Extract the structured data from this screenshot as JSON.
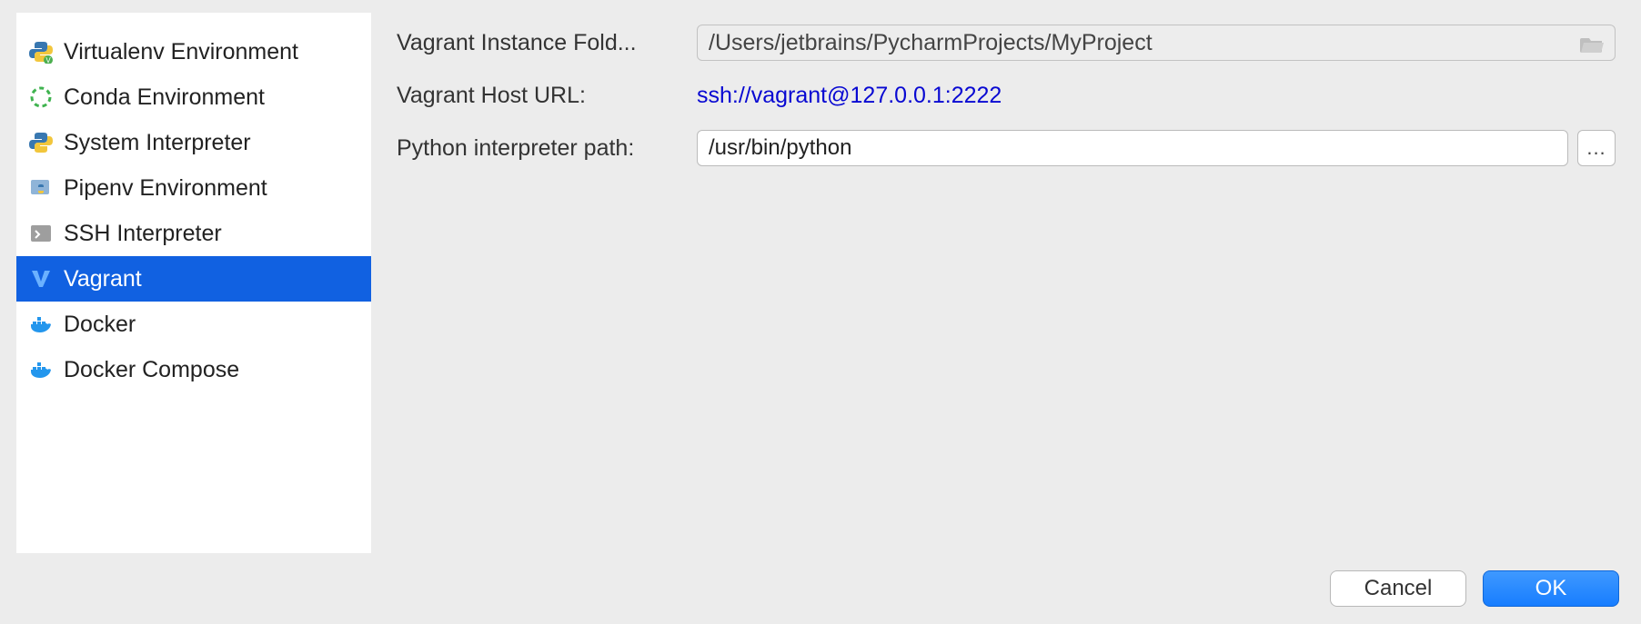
{
  "sidebar": {
    "items": [
      {
        "label": "Virtualenv Environment",
        "icon": "python-v",
        "selected": false
      },
      {
        "label": "Conda Environment",
        "icon": "conda",
        "selected": false
      },
      {
        "label": "System Interpreter",
        "icon": "python",
        "selected": false
      },
      {
        "label": "Pipenv Environment",
        "icon": "pipenv",
        "selected": false
      },
      {
        "label": "SSH Interpreter",
        "icon": "ssh",
        "selected": false
      },
      {
        "label": "Vagrant",
        "icon": "vagrant",
        "selected": true
      },
      {
        "label": "Docker",
        "icon": "docker",
        "selected": false
      },
      {
        "label": "Docker Compose",
        "icon": "docker",
        "selected": false
      }
    ]
  },
  "form": {
    "instance_folder_label": "Vagrant Instance Fold...",
    "instance_folder_value": "/Users/jetbrains/PycharmProjects/MyProject",
    "host_url_label": "Vagrant Host URL:",
    "host_url_value": "ssh://vagrant@127.0.0.1:2222",
    "interpreter_path_label": "Python interpreter path:",
    "interpreter_path_value": "/usr/bin/python",
    "browse_label": "..."
  },
  "buttons": {
    "cancel": "Cancel",
    "ok": "OK"
  }
}
